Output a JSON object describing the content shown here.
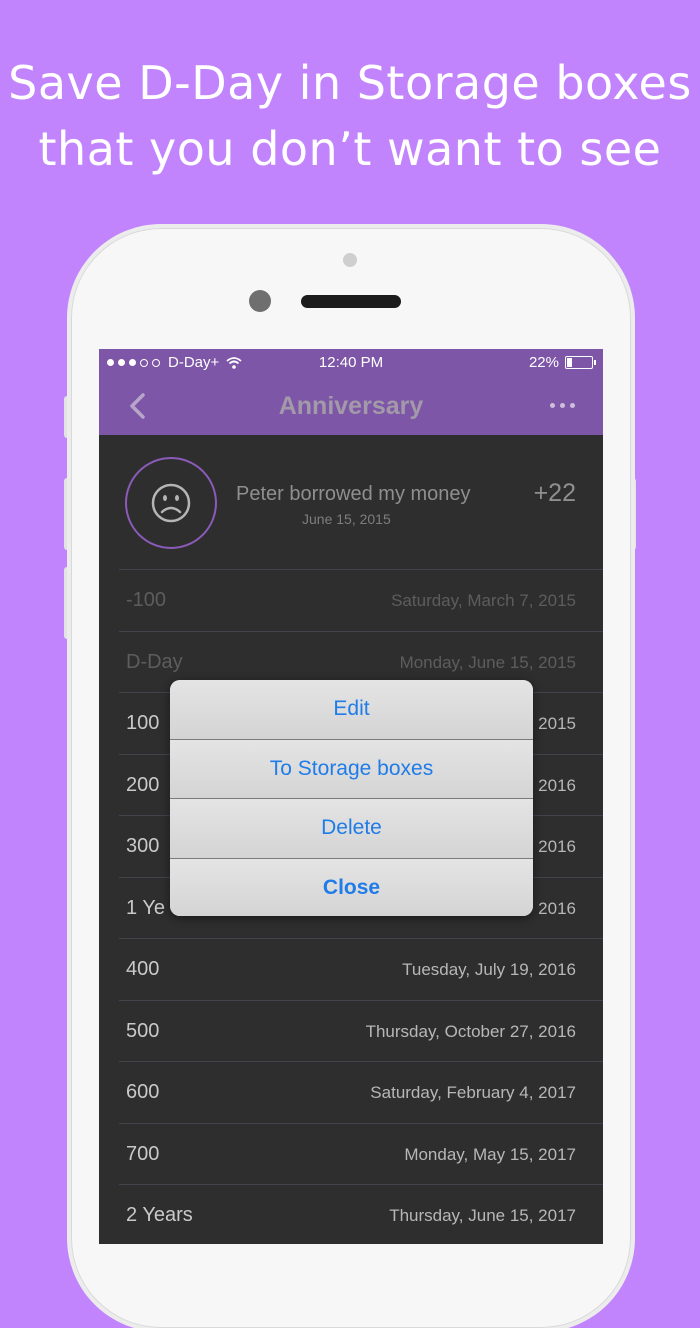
{
  "promo": {
    "line1": "Save D-Day in Storage boxes",
    "line2": "that you don’t want to see"
  },
  "status_bar": {
    "carrier": "D-Day+",
    "time": "12:40 PM",
    "battery": "22%"
  },
  "nav": {
    "title": "Anniversary"
  },
  "event": {
    "title": "Peter borrowed my money",
    "date": "June 15, 2015",
    "count": "+22"
  },
  "rows": [
    {
      "label": "-100",
      "date": "Saturday, March 7, 2015"
    },
    {
      "label": "D-Day",
      "date": "Monday, June 15, 2015"
    },
    {
      "label": "100",
      "date": "2015"
    },
    {
      "label": "200",
      "date": "2016"
    },
    {
      "label": "300",
      "date": "2016"
    },
    {
      "label": "1 Ye",
      "date": "2016"
    },
    {
      "label": "400",
      "date": "Tuesday, July 19, 2016"
    },
    {
      "label": "500",
      "date": "Thursday, October 27, 2016"
    },
    {
      "label": "600",
      "date": "Saturday, February 4, 2017"
    },
    {
      "label": "700",
      "date": "Monday, May 15, 2017"
    },
    {
      "label": "2 Years",
      "date": "Thursday, June 15, 2017"
    }
  ],
  "action_sheet": {
    "edit": "Edit",
    "storage": "To Storage boxes",
    "delete": "Delete",
    "close": "Close"
  },
  "colors": {
    "background": "#c184fc",
    "nav": "#7d56a7",
    "action_text": "#1f7ce8"
  }
}
